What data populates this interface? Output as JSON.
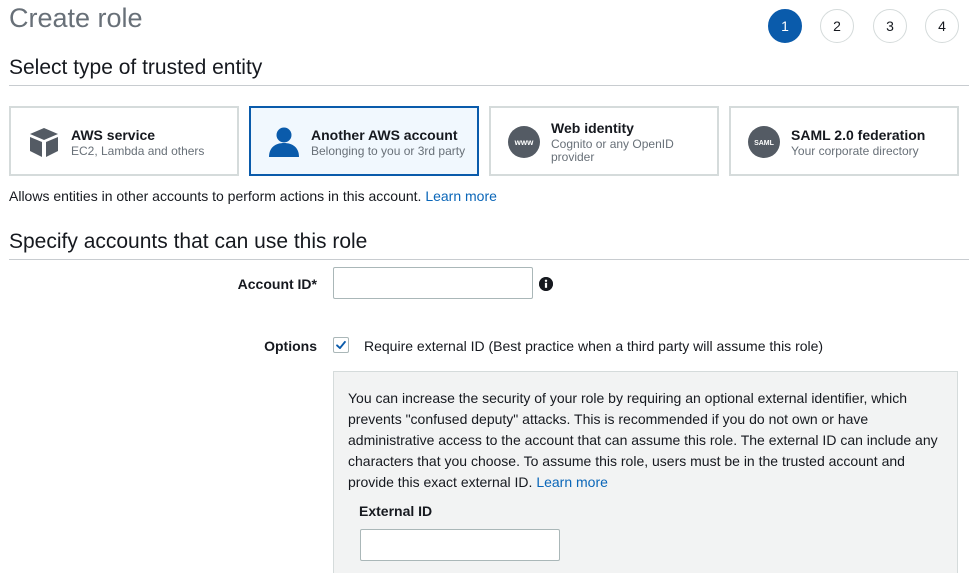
{
  "page": {
    "title": "Create role"
  },
  "steps": [
    {
      "label": "1",
      "active": true
    },
    {
      "label": "2",
      "active": false
    },
    {
      "label": "3",
      "active": false
    },
    {
      "label": "4",
      "active": false
    }
  ],
  "trusted_entity": {
    "heading": "Select type of trusted entity",
    "cards": [
      {
        "title": "AWS service",
        "subtitle": "EC2, Lambda and others",
        "icon": "cube-icon",
        "selected": false
      },
      {
        "title": "Another AWS account",
        "subtitle": "Belonging to you or 3rd party",
        "icon": "user-icon",
        "selected": true
      },
      {
        "title": "Web identity",
        "subtitle": "Cognito or any OpenID provider",
        "icon": "www-icon",
        "icon_text": "www",
        "selected": false
      },
      {
        "title": "SAML 2.0 federation",
        "subtitle": "Your corporate directory",
        "icon": "saml-icon",
        "icon_text": "SAML",
        "selected": false
      }
    ],
    "description": "Allows entities in other accounts to perform actions in this account.",
    "learn_more": "Learn more"
  },
  "accounts": {
    "heading": "Specify accounts that can use this role",
    "account_id_label": "Account ID*",
    "account_id_value": "",
    "options_label": "Options",
    "require_external_id_label": "Require external ID (Best practice when a third party will assume this role)",
    "require_external_id_checked": true,
    "panel_text": "You can increase the security of your role by requiring an optional external identifier, which prevents \"confused deputy\" attacks. This is recommended if you do not own or have administrative access to the account that can assume this role. The external ID can include any characters that you choose. To assume this role, users must be in the trusted account and provide this exact external ID.",
    "panel_learn_more": "Learn more",
    "external_id_label": "External ID",
    "external_id_value": ""
  },
  "colors": {
    "accent": "#0a5bab",
    "link": "#0a66b8",
    "selected_card_bg": "#f1f8fe",
    "panel_bg": "#f2f3f3"
  }
}
